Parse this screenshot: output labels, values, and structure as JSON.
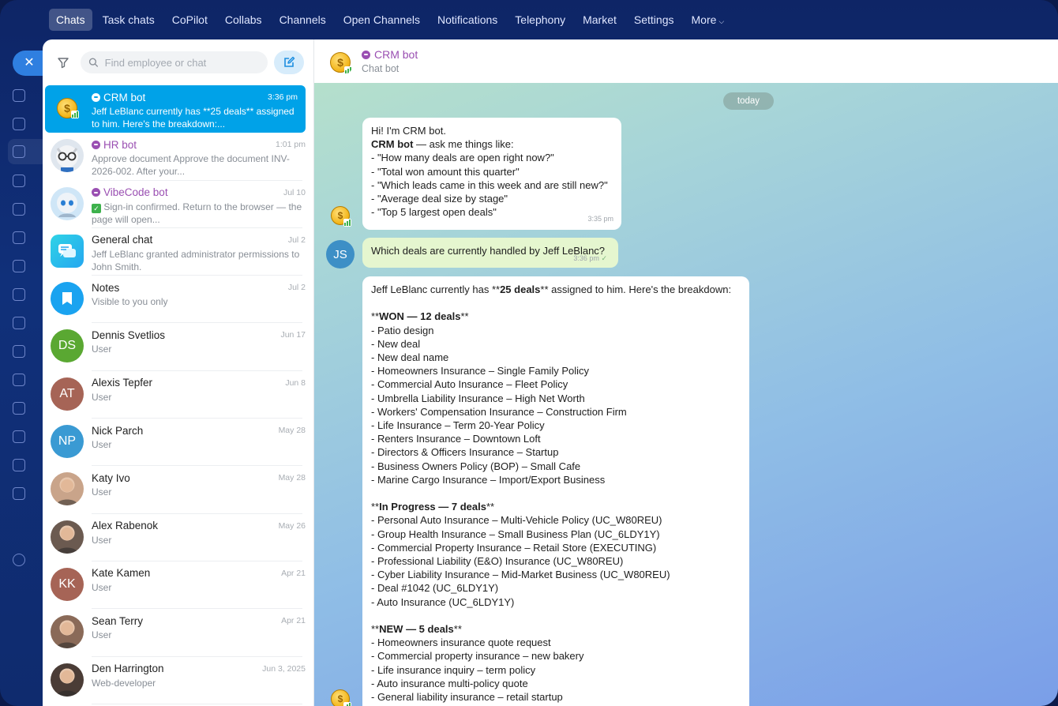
{
  "nav": {
    "items": [
      "Chats",
      "Task chats",
      "CoPilot",
      "Collabs",
      "Channels",
      "Open Channels",
      "Notifications",
      "Telephony",
      "Market",
      "Settings",
      "More"
    ],
    "active": "Chats"
  },
  "rail": {
    "close_label": "✕"
  },
  "search": {
    "placeholder": "Find employee or chat"
  },
  "chats": [
    {
      "name": "CRM bot",
      "bot": true,
      "time": "3:36 pm",
      "preview": "Jeff LeBlanc currently has **25 deals** assigned to him. Here's the breakdown:...",
      "avatar": "coin",
      "selected": true
    },
    {
      "name": "HR bot",
      "bot": true,
      "time": "1:01 pm",
      "preview": "Approve document Approve the document INV-2026-002. After your...",
      "avatar": "hr"
    },
    {
      "name": "VibeCode bot",
      "bot": true,
      "time": "Jul 10",
      "preview": "Sign-in confirmed. Return to the browser — the page will open...",
      "avatar": "vibe",
      "check": true
    },
    {
      "name": "General chat",
      "bot": false,
      "time": "Jul 2",
      "preview": "Jeff LeBlanc granted administrator permissions to John Smith.",
      "avatar": "general"
    },
    {
      "name": "Notes",
      "bot": false,
      "time": "Jul 2",
      "preview": "Visible to you only",
      "avatar": "notes"
    },
    {
      "name": "Dennis Svetlios",
      "bot": false,
      "time": "Jun 17",
      "preview": "User",
      "avatar": "initials",
      "initials": "DS",
      "color": "#5aa832"
    },
    {
      "name": "Alexis Tepfer",
      "bot": false,
      "time": "Jun 8",
      "preview": "User",
      "avatar": "initials",
      "initials": "AT",
      "color": "#a66456"
    },
    {
      "name": "Nick Parch",
      "bot": false,
      "time": "May 28",
      "preview": "User",
      "avatar": "initials",
      "initials": "NP",
      "color": "#3a9ad3"
    },
    {
      "name": "Katy Ivo",
      "bot": false,
      "time": "May 28",
      "preview": "User",
      "avatar": "photo",
      "color": "#c9a48a"
    },
    {
      "name": "Alex Rabenok",
      "bot": false,
      "time": "May 26",
      "preview": "User",
      "avatar": "photo",
      "color": "#6b5a50"
    },
    {
      "name": "Kate Kamen",
      "bot": false,
      "time": "Apr 21",
      "preview": "User",
      "avatar": "initials",
      "initials": "KK",
      "color": "#a66456"
    },
    {
      "name": "Sean Terry",
      "bot": false,
      "time": "Apr 21",
      "preview": "User",
      "avatar": "photo",
      "color": "#8a6a58"
    },
    {
      "name": "Den Harrington",
      "bot": false,
      "time": "Jun 3, 2025",
      "preview": "Web-developer",
      "avatar": "photo",
      "color": "#4a3c36"
    }
  ],
  "header": {
    "title": "CRM bot",
    "subtitle": "Chat bot"
  },
  "date_pill": "today",
  "messages": {
    "intro": {
      "lines": [
        "Hi! I'm CRM bot."
      ],
      "bold_prefix": "CRM bot",
      "bold_rest": " — ask me things like:",
      "items": [
        "- \"How many deals are open right now?\"",
        "- \"Total won amount this quarter\"",
        "- \"Which leads came in this week and are still new?\"",
        "- \"Average deal size by stage\"",
        "- \"Top 5 largest open deals\""
      ],
      "time": "3:35 pm"
    },
    "user": {
      "initials": "JS",
      "text": "Which deals are currently handled by Jeff LeBlanc?",
      "time": "3:36 pm"
    },
    "reply": {
      "intro_a": "Jeff LeBlanc currently has **",
      "intro_b": "25 deals",
      "intro_c": "** assigned to him. Here's the breakdown:",
      "won_a": "**",
      "won_b": "WON — 12 deals",
      "won_c": "**",
      "won": [
        "- Patio design",
        "- New deal",
        "- New deal name",
        "- Homeowners Insurance – Single Family Policy",
        "- Commercial Auto Insurance – Fleet Policy",
        "- Umbrella Liability Insurance – High Net Worth",
        "- Workers' Compensation Insurance – Construction Firm",
        "- Life Insurance – Term 20-Year Policy",
        "- Renters Insurance – Downtown Loft",
        "- Directors & Officers Insurance – Startup",
        "- Business Owners Policy (BOP) – Small Cafe",
        "- Marine Cargo Insurance – Import/Export Business"
      ],
      "prog_a": "**",
      "prog_b": "In Progress — 7 deals",
      "prog_c": "**",
      "progress": [
        "- Personal Auto Insurance – Multi-Vehicle Policy (UC_W80REU)",
        "- Group Health Insurance – Small Business Plan (UC_6LDY1Y)",
        "- Commercial Property Insurance – Retail Store (EXECUTING)",
        "- Professional Liability (E&O) Insurance (UC_W80REU)",
        "- Cyber Liability Insurance – Mid-Market Business (UC_W80REU)",
        "- Deal #1042 (UC_6LDY1Y)",
        "- Auto Insurance (UC_6LDY1Y)"
      ],
      "new_a": "**",
      "new_b": "NEW — 5 deals",
      "new_c": "**",
      "new": [
        "- Homeowners insurance quote request",
        "- Commercial property insurance – new bakery",
        "- Life insurance inquiry – term policy",
        "- Auto insurance multi-policy quote",
        "- General liability insurance – retail startup"
      ]
    }
  }
}
